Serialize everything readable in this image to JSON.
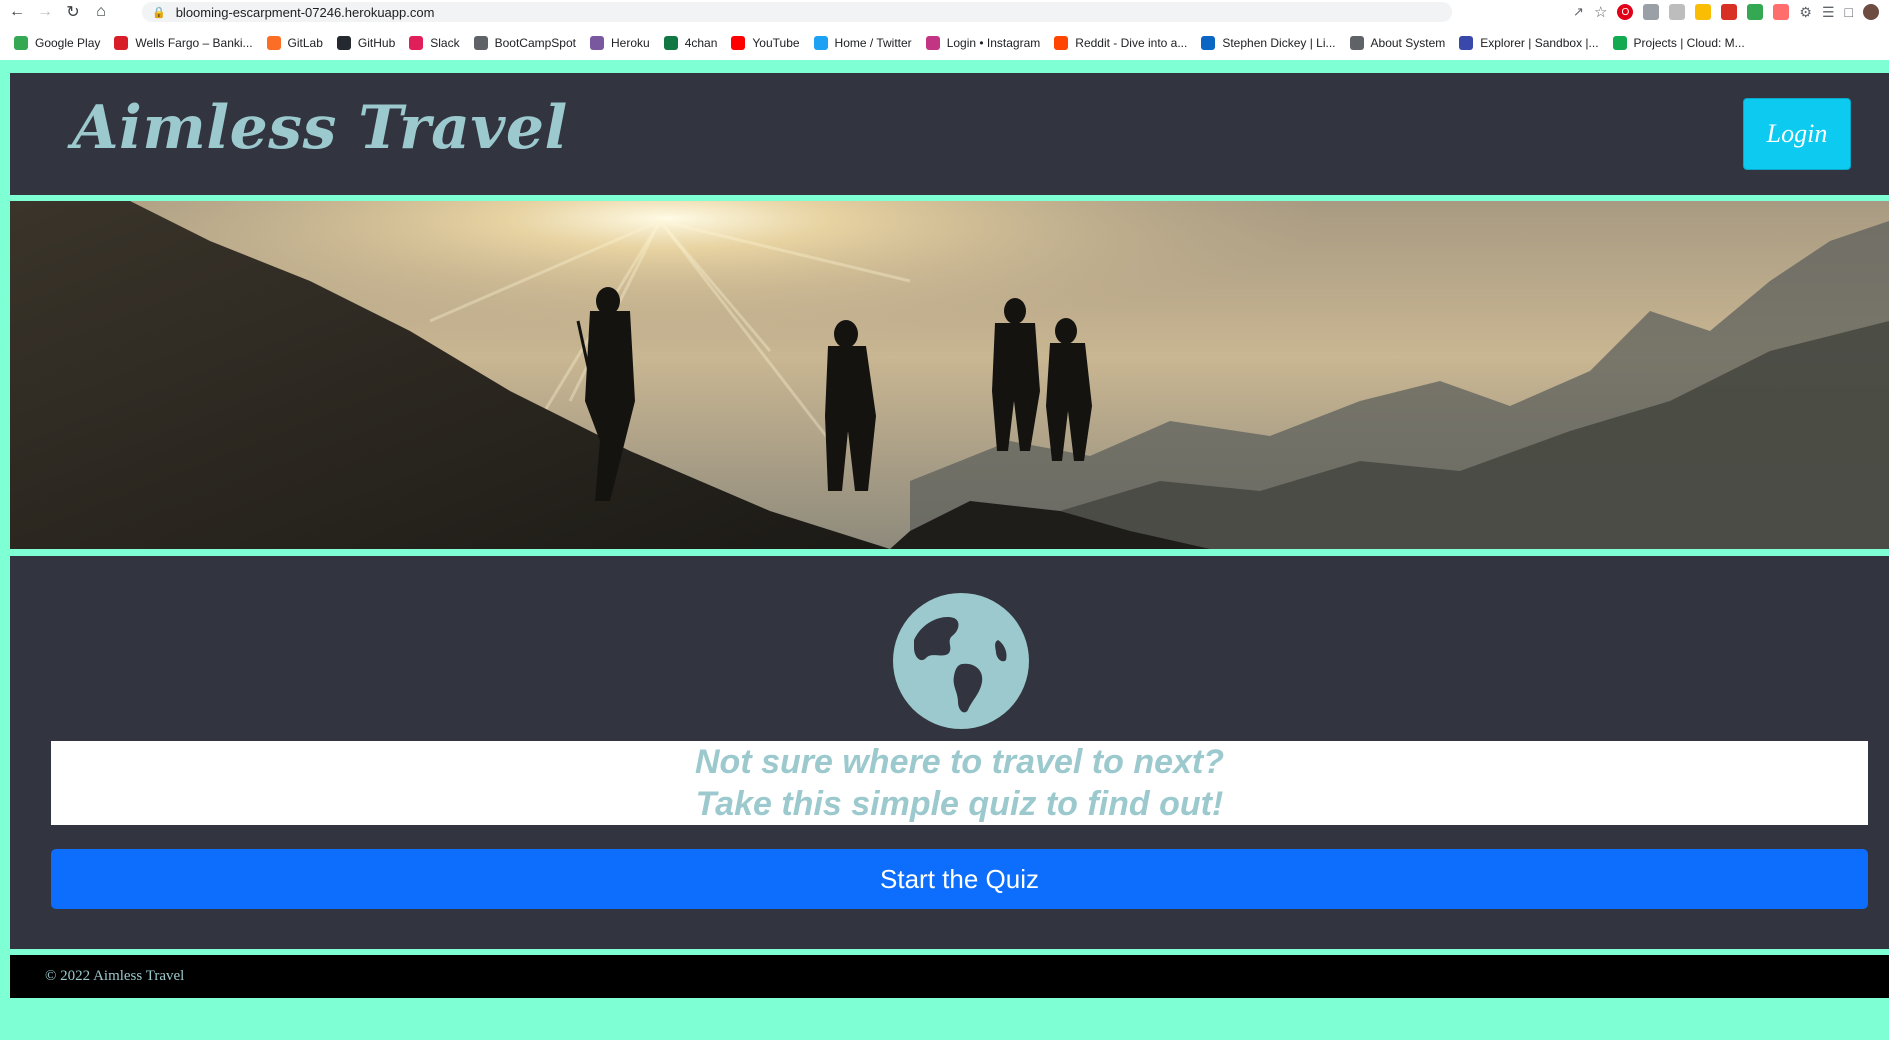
{
  "browser": {
    "url": "blooming-escarpment-07246.herokuapp.com",
    "bookmarks": [
      {
        "label": "Google Play",
        "icon": "google-play-icon",
        "color": "#34a853"
      },
      {
        "label": "Wells Fargo – Banki...",
        "icon": "wells-fargo-icon",
        "color": "#d71e28"
      },
      {
        "label": "GitLab",
        "icon": "gitlab-icon",
        "color": "#fc6d26"
      },
      {
        "label": "GitHub",
        "icon": "github-icon",
        "color": "#24292f"
      },
      {
        "label": "Slack",
        "icon": "slack-icon",
        "color": "#e01e5a"
      },
      {
        "label": "BootCampSpot",
        "icon": "globe-icon",
        "color": "#5f6368"
      },
      {
        "label": "Heroku",
        "icon": "heroku-icon",
        "color": "#79589f"
      },
      {
        "label": "4chan",
        "icon": "clover-icon",
        "color": "#117743"
      },
      {
        "label": "YouTube",
        "icon": "youtube-icon",
        "color": "#ff0000"
      },
      {
        "label": "Home / Twitter",
        "icon": "twitter-icon",
        "color": "#1da1f2"
      },
      {
        "label": "Login • Instagram",
        "icon": "instagram-icon",
        "color": "#c13584"
      },
      {
        "label": "Reddit - Dive into a...",
        "icon": "reddit-icon",
        "color": "#ff4500"
      },
      {
        "label": "Stephen Dickey | Li...",
        "icon": "linkedin-icon",
        "color": "#0a66c2"
      },
      {
        "label": "About System",
        "icon": "globe-icon",
        "color": "#5f6368"
      },
      {
        "label": "Explorer | Sandbox |...",
        "icon": "explorer-icon",
        "color": "#3949ab"
      },
      {
        "label": "Projects | Cloud: M...",
        "icon": "mongodb-icon",
        "color": "#13aa52"
      }
    ]
  },
  "header": {
    "brand": "Aimless Travel",
    "login_label": "Login"
  },
  "main": {
    "tagline_line1": "Not sure where to travel to next?",
    "tagline_line2": "Take this simple quiz to find out!",
    "start_label": "Start the Quiz"
  },
  "footer": {
    "text": "© 2022 Aimless Travel"
  },
  "colors": {
    "page_border": "#7fffd4",
    "panel": "#32343f",
    "accent_text": "#9bc9cd",
    "login_button": "#0dcaf0",
    "start_button": "#0d6efd"
  }
}
